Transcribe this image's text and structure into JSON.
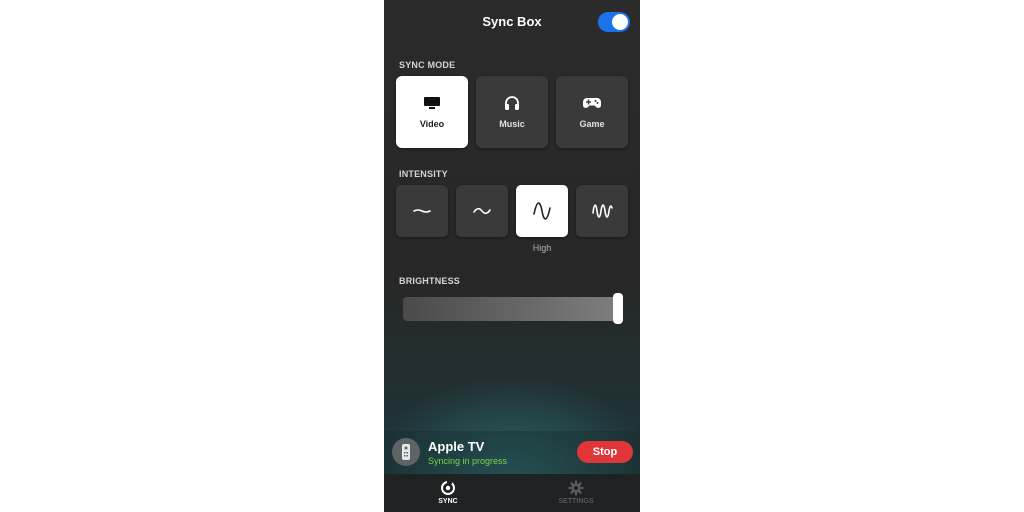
{
  "header": {
    "title": "Sync Box",
    "power_toggle": {
      "on": true
    }
  },
  "sync_mode": {
    "label": "SYNC MODE",
    "options": [
      {
        "label": "Video",
        "icon": "tv-icon",
        "selected": true
      },
      {
        "label": "Music",
        "icon": "headphones-icon",
        "selected": false
      },
      {
        "label": "Game",
        "icon": "gamepad-icon",
        "selected": false
      }
    ]
  },
  "intensity": {
    "label": "INTENSITY",
    "options": [
      {
        "icon": "wave-subtle-icon",
        "selected": false
      },
      {
        "icon": "wave-moderate-icon",
        "selected": false
      },
      {
        "icon": "wave-high-icon",
        "selected": true
      },
      {
        "icon": "wave-intense-icon",
        "selected": false
      }
    ],
    "selected_label": "High"
  },
  "brightness": {
    "label": "BRIGHTNESS",
    "value_fraction": 1.0
  },
  "now_syncing": {
    "device": "Apple TV",
    "status": "Syncing in progress",
    "stop_label": "Stop",
    "status_color": "#7bd34a",
    "stop_color": "#e0363a"
  },
  "tabs": [
    {
      "label": "SYNC",
      "icon": "sync-icon",
      "active": true
    },
    {
      "label": "SETTINGS",
      "icon": "gear-icon",
      "active": false
    }
  ],
  "colors": {
    "accent": "#1a73e8",
    "background": "#2b2b2b"
  }
}
